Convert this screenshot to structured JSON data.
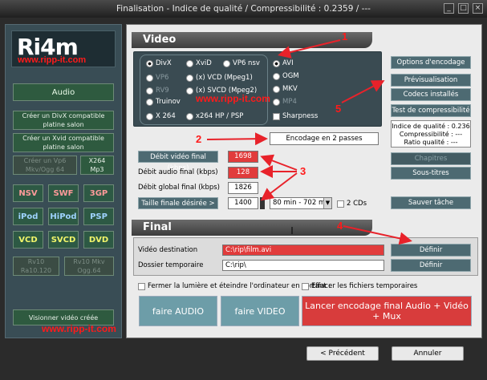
{
  "window": {
    "title": "Finalisation - Indice de qualité / Compressibilité : 0.2359 / ---",
    "min": "_",
    "max": "□",
    "close": "×"
  },
  "logo": {
    "text": "Ri4m"
  },
  "watermark": "www.ripp-it.com",
  "left": {
    "audio": "Audio",
    "divx": "Créer un DivX compatible platine salon",
    "xvid": "Créer un Xvid compatible platine salon",
    "vp6": "Créer un Vp6 Mkv/Ogg 64",
    "x264": "X264 Mp3",
    "formats": [
      "NSV",
      "SWF",
      "3GP",
      "iPod",
      "HiPod",
      "PSP",
      "VCD",
      "SVCD",
      "DVD"
    ],
    "rv10": "Rv10 Ra10.120",
    "rv10mkv": "Rv10 Mkv Ogg.64",
    "view": "Visionner vidéo créée"
  },
  "video": {
    "header": "Video",
    "codecs": [
      "DivX",
      "XviD",
      "VP6 nsv",
      "VP6",
      "(x) VCD (Mpeg1)",
      "RV9",
      "(x) SVCD (Mpeg2)",
      "Truinov",
      "X 264",
      "x264 HP / PSP"
    ],
    "containers": [
      "AVI",
      "OGM",
      "MKV",
      "MP4"
    ],
    "sharpness": "Sharpness",
    "encode_mode": "Encodage en 2 passes",
    "buttons": [
      "Options d'encodage",
      "Prévisualisation",
      "Codecs installés",
      "Test de compressibilité"
    ],
    "quality": [
      "Indice de qualité : 0.236",
      "Compressibilité : ---",
      "Ratio qualité : ---"
    ],
    "chapitres": "Chapitres",
    "soustitres": "Sous-titres",
    "sauver": "Sauver tâche",
    "rates": {
      "video_label": "Débit vidéo final (kbps)",
      "video_value": "1698",
      "audio_label": "Débit audio final (kbps)",
      "audio_value": "128",
      "global_label": "Débit global final (kbps)",
      "global_value": "1826",
      "size_label": "Taille finale désirée >",
      "size_value": "1400",
      "preset": "80 min - 702 mo",
      "two_cds": "2 CDs"
    }
  },
  "final": {
    "header": "Final",
    "dest_label": "Vidéo destination",
    "dest_value": "C:\\rip\\film.avi",
    "temp_label": "Dossier temporaire",
    "temp_value": "C:\\rip\\",
    "define": "Définir",
    "chk1": "Fermer la lumière et éteindre l'ordinateur en sortant :",
    "chk2": "Effacer les fichiers temporaires",
    "audio_btn": "faire AUDIO",
    "video_btn": "faire VIDEO",
    "launch": "Lancer encodage final Audio + Vidéo + Mux"
  },
  "nav": {
    "prev": "< Précédent",
    "cancel": "Annuler"
  },
  "annotations": [
    "1",
    "2",
    "3",
    "4",
    "5"
  ],
  "colors": {
    "arrow": "#e8222a",
    "red_field": "#e13b3b",
    "panel": "#3a4b52"
  }
}
